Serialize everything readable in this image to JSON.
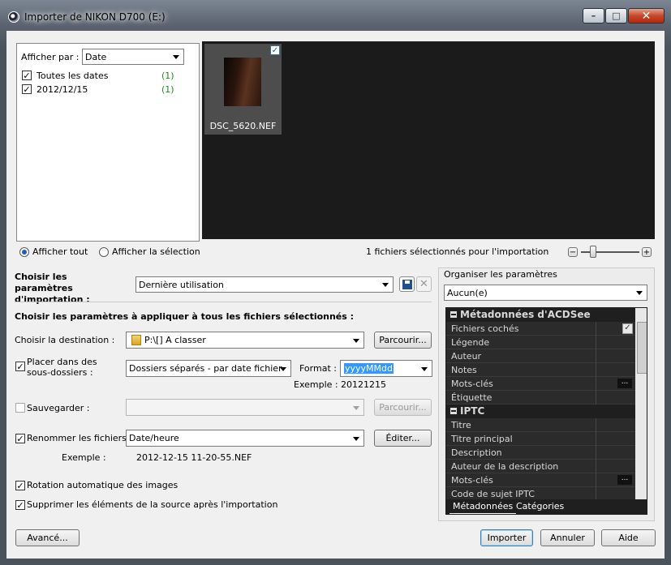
{
  "window": {
    "title": "Importer de NIKON D700 (E:)",
    "minimize": "–",
    "maximize": "□",
    "close": "✕"
  },
  "filter": {
    "label": "Afficher par :",
    "selected": "Date",
    "items": [
      {
        "label": "Toutes les dates",
        "count": "(1)",
        "checked": "✓"
      },
      {
        "label": "2012/12/15",
        "count": "(1)",
        "checked": "✓"
      }
    ]
  },
  "thumbnail": {
    "name": "DSC_5620.NEF",
    "checked": "✓"
  },
  "view": {
    "show_all": "Afficher tout",
    "show_selection": "Afficher la sélection",
    "selection_status": "1 fichiers sélectionnés pour l'importation",
    "zoom_minus": "−",
    "zoom_plus": "+"
  },
  "import_settings": {
    "label": "Choisir les paramètres d'importation :",
    "selected": "Dernière utilisation"
  },
  "apply_section": {
    "heading": "Choisir les paramètres à appliquer à tous les fichiers sélectionnés :",
    "destination_label": "Choisir la destination :",
    "destination_value": "P:\\[] A classer",
    "browse": "Parcourir...",
    "subfolders_label": "Placer dans des sous-dossiers :",
    "subfolders_value": "Dossiers séparés - par date fichier",
    "format_label": "Format :",
    "format_value": "yyyyMMdd",
    "example_label": "Exemple :",
    "example_value": "20121215",
    "backup_label": "Sauvegarder :",
    "backup_browse": "Parcourir...",
    "rename_label": "Renommer les fichiers:",
    "rename_value": "Date/heure",
    "edit": "Éditer...",
    "rename_example_label": "Exemple :",
    "rename_example_value": "2012-12-15 11-20-55.NEF",
    "rotate_label": "Rotation automatique des images",
    "delete_label": "Supprimer les éléments de la source après l'importation",
    "check": "✓"
  },
  "organize": {
    "label": "Organiser les paramètres",
    "selected": "Aucun(e)",
    "groups": [
      {
        "title": "Métadonnées d'ACDSee",
        "fields": [
          "Fichiers cochés",
          "Légende",
          "Auteur",
          "Notes",
          "Mots-clés",
          "Étiquette"
        ]
      },
      {
        "title": "IPTC",
        "fields": [
          "Titre",
          "Titre principal",
          "Description",
          "Auteur de la description",
          "Mots-clés",
          "Code de sujet IPTC"
        ]
      }
    ],
    "ellipsis": "...",
    "checked_mark": "✓",
    "tabs": [
      "Métadonnées",
      "Catégories"
    ]
  },
  "footer": {
    "advanced": "Avancé...",
    "import": "Importer",
    "cancel": "Annuler",
    "help": "Aide"
  },
  "icons": {
    "save": "save-icon",
    "delete": "delete-icon",
    "folder": "folder-icon"
  }
}
